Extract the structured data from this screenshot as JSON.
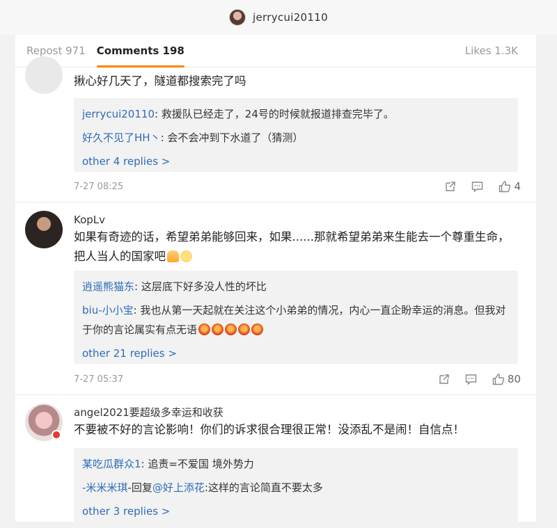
{
  "header": {
    "username": "jerrycui20110"
  },
  "tabs": {
    "repost": "Repost 971",
    "comments": "Comments 198",
    "likes": "Likes 1.3K"
  },
  "comments": [
    {
      "text": "揪心好几天了，隧道都搜索完了吗",
      "replies": [
        {
          "name": "jerrycui20110",
          "text": ": 救援队已经走了，24号的时候就报道排查完毕了。"
        },
        {
          "name": "好久不见了HH丶",
          "text": ": 会不会冲到下水道了（猜测）"
        }
      ],
      "more": "other 4 replies >",
      "time": "7-27 08:25",
      "likes": "4"
    },
    {
      "username": "KopLv",
      "text": "如果有奇迹的话，希望弟弟能够回来，如果......那就希望弟弟来生能去一个尊重生命，把人当人的国家吧",
      "replies": [
        {
          "name": "逍遥熊猫东",
          "text": ": 这层底下好多没人性的坏比"
        },
        {
          "name": "biu-小小宝",
          "text": ": 我也从第一天起就在关注这个小弟弟的情况，内心一直企盼幸运的消息。但我对于你的言论属实有点无语"
        }
      ],
      "more": "other 21 replies >",
      "time": "7-27 05:37",
      "likes": "80"
    },
    {
      "username": "angel2021要超级多幸运和收获",
      "text": "不要被不好的言论影响！你们的诉求很合理很正常！没添乱不是闹！自信点！",
      "replies": [
        {
          "name": "某吃瓜群众1",
          "text": ": 追责=不爱国 境外势力"
        },
        {
          "name": "-米米米琪",
          "text": "-回复",
          "mention": "@好上添花",
          "text2": ":这样的言论简直不要太多"
        }
      ],
      "more": "other 3 replies >"
    }
  ]
}
